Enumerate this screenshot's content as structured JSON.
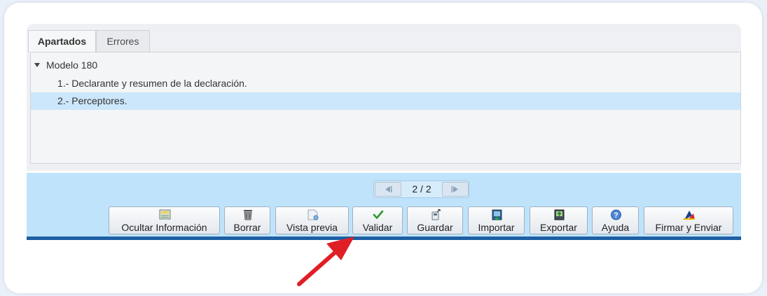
{
  "tabs": [
    {
      "label": "Apartados",
      "active": true
    },
    {
      "label": "Errores",
      "active": false
    }
  ],
  "tree": {
    "root": "Modelo 180",
    "items": [
      {
        "label": "1.- Declarante y resumen de la declaración.",
        "selected": false
      },
      {
        "label": "2.- Perceptores.",
        "selected": true
      }
    ]
  },
  "pager": {
    "current": "2",
    "separator": "/",
    "total": "2"
  },
  "toolbar": {
    "ocultar": "Ocultar Información",
    "borrar": "Borrar",
    "vista_previa": "Vista previa",
    "validar": "Validar",
    "guardar": "Guardar",
    "importar": "Importar",
    "exportar": "Exportar",
    "ayuda": "Ayuda",
    "firmar": "Firmar y Enviar"
  },
  "icons": {
    "ocultar": "info-panel-icon",
    "borrar": "trash-icon",
    "vista_previa": "document-preview-icon",
    "validar": "checkmark-icon",
    "guardar": "save-icon",
    "importar": "import-icon",
    "exportar": "export-icon",
    "ayuda": "help-icon",
    "firmar": "agency-logo-icon"
  },
  "colors": {
    "toolbar_bg": "#bfe3fb",
    "toolbar_border": "#1d5fa4",
    "selected_row": "#cce7fb",
    "annotation_arrow": "#e01e26"
  }
}
